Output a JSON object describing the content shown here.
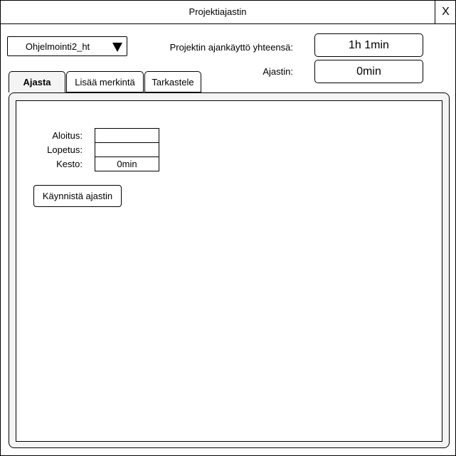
{
  "window": {
    "title": "Projektiajastin",
    "close_label": "X"
  },
  "project_selector": {
    "selected": "Ohjelmointi2_ht"
  },
  "summary": {
    "total_label": "Projektin ajankäyttö yhteensä:",
    "total_value": "1h 1min",
    "timer_label": "Ajastin:",
    "timer_value": "0min"
  },
  "tabs": [
    {
      "label": "Ajasta",
      "active": true
    },
    {
      "label": "Lisää merkintä",
      "active": false
    },
    {
      "label": "Tarkastele",
      "active": false
    }
  ],
  "timer_form": {
    "start_label": "Aloitus:",
    "start_value": "",
    "end_label": "Lopetus:",
    "end_value": "",
    "duration_label": "Kesto:",
    "duration_value": "0min",
    "start_button": "Käynnistä ajastin"
  }
}
